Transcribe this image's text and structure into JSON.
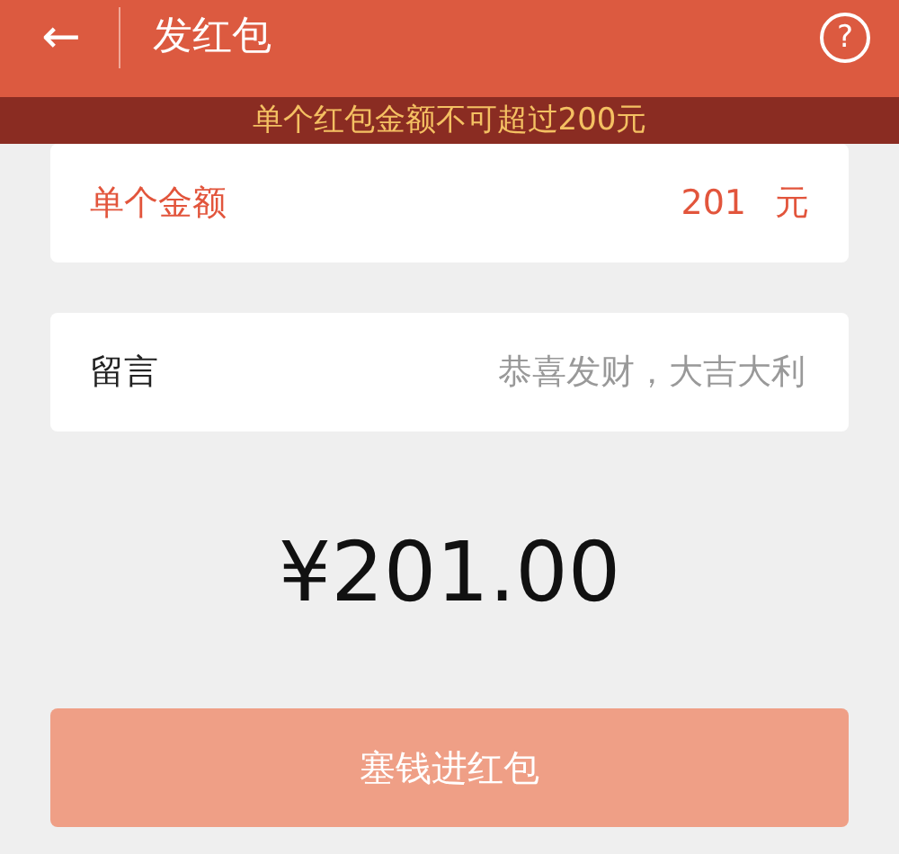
{
  "header": {
    "back": "←",
    "title": "发红包",
    "help": "?"
  },
  "warning": "单个红包金额不可超过200元",
  "amount_field": {
    "label": "单个金额",
    "value": "201",
    "unit": "元",
    "error": true
  },
  "message_field": {
    "label": "留言",
    "placeholder": "恭喜发财，大吉大利"
  },
  "total": "¥201.00",
  "submit": {
    "label": "塞钱进红包",
    "disabled": true
  }
}
